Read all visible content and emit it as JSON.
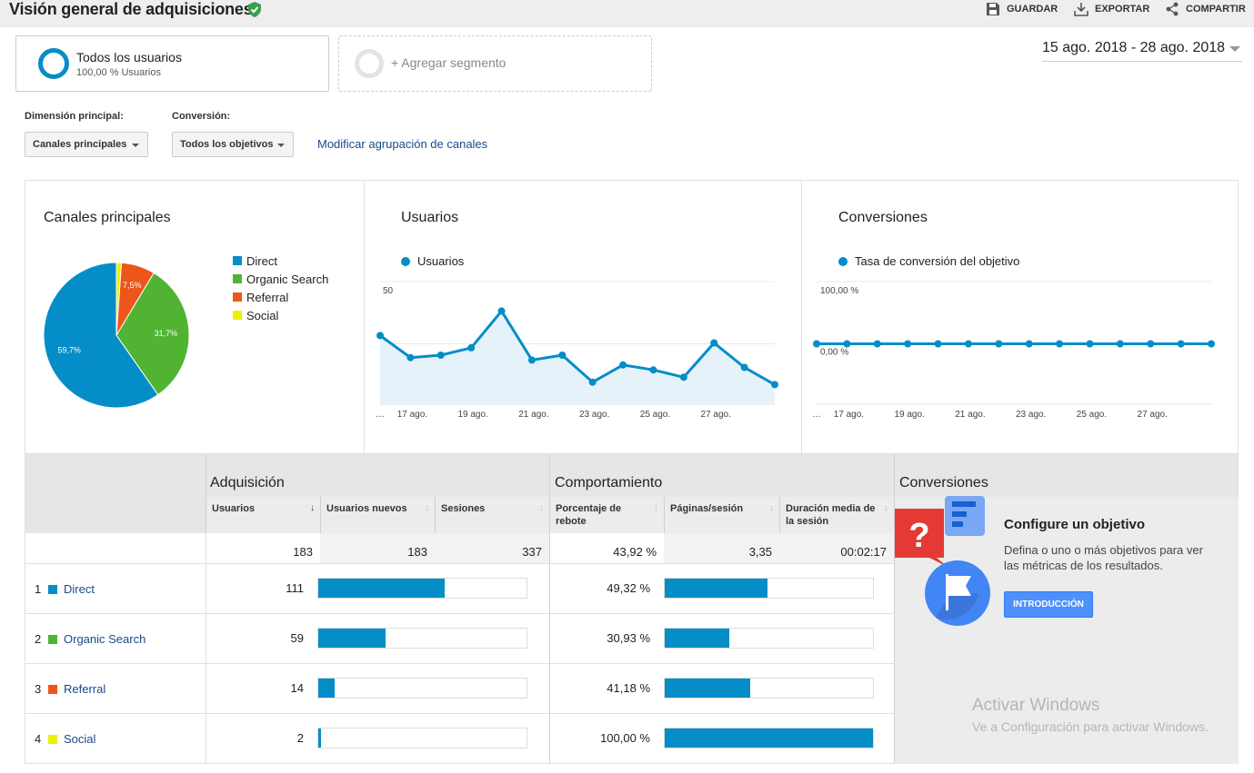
{
  "header": {
    "title": "Visión general de adquisiciones",
    "save_label": "GUARDAR",
    "export_label": "EXPORTAR",
    "share_label": "COMPARTIR"
  },
  "segments": {
    "active_name": "Todos los usuarios",
    "active_sub": "100,00 % Usuarios",
    "add_label": "+ Agregar segmento"
  },
  "date_range": "15 ago. 2018 - 28 ago. 2018",
  "dimensions": {
    "primary_label": "Dimensión principal:",
    "primary_value": "Canales principales",
    "conversion_label": "Conversión:",
    "conversion_value": "Todos los objetivos",
    "modify_link": "Modificar agrupación de canales"
  },
  "colors": {
    "direct": "#058dc7",
    "organic": "#50b432",
    "referral": "#ed561b",
    "social": "#edef00",
    "accent": "#058dc7"
  },
  "chart_data": [
    {
      "type": "pie",
      "title": "Canales principales",
      "categories": [
        "Direct",
        "Organic Search",
        "Referral",
        "Social"
      ],
      "values": [
        59.7,
        31.7,
        7.5,
        1.1
      ],
      "labels": [
        "59,7%",
        "31,7%",
        "7,5%",
        ""
      ]
    },
    {
      "type": "area",
      "title": "Usuarios",
      "series": [
        {
          "name": "Usuarios",
          "values": [
            28,
            19,
            20,
            23,
            38,
            18,
            20,
            9,
            16,
            14,
            11,
            25,
            15,
            8
          ]
        }
      ],
      "yticks": [
        "50",
        "25"
      ],
      "ylim": [
        0,
        50
      ],
      "xticks": [
        "…",
        "17 ago.",
        "19 ago.",
        "21 ago.",
        "23 ago.",
        "25 ago.",
        "27 ago."
      ]
    },
    {
      "type": "line",
      "title": "Conversiones",
      "series": [
        {
          "name": "Tasa de conversión del objetivo",
          "values": [
            0,
            0,
            0,
            0,
            0,
            0,
            0,
            0,
            0,
            0,
            0,
            0,
            0,
            0
          ]
        }
      ],
      "yticks": [
        "100,00 %",
        "0,00 %"
      ],
      "xticks": [
        "…",
        "17 ago.",
        "19 ago.",
        "21 ago.",
        "23 ago.",
        "25 ago.",
        "27 ago."
      ]
    }
  ],
  "table": {
    "group_acq": "Adquisición",
    "group_beh": "Comportamiento",
    "group_conv": "Conversiones",
    "columns": [
      "Usuarios",
      "Usuarios nuevos",
      "Sesiones",
      "Porcentaje de rebote",
      "Páginas/sesión",
      "Duración media de la sesión"
    ],
    "totals": [
      "183",
      "183",
      "337",
      "43,92 %",
      "3,35",
      "00:02:17"
    ],
    "rows": [
      {
        "num": "1",
        "name": "Direct",
        "users": "111",
        "users_fraction": 0.607,
        "bounce": "49,32 %",
        "bounce_fraction": 0.493
      },
      {
        "num": "2",
        "name": "Organic Search",
        "users": "59",
        "users_fraction": 0.322,
        "bounce": "30,93 %",
        "bounce_fraction": 0.309
      },
      {
        "num": "3",
        "name": "Referral",
        "users": "14",
        "users_fraction": 0.077,
        "bounce": "41,18 %",
        "bounce_fraction": 0.412
      },
      {
        "num": "4",
        "name": "Social",
        "users": "2",
        "users_fraction": 0.011,
        "bounce": "100,00 %",
        "bounce_fraction": 1.0
      }
    ]
  },
  "goal": {
    "title": "Configure un objetivo",
    "text": "Defina o uno o más objetivos para ver las métricas de los resultados.",
    "button": "INTRODUCCIÓN"
  },
  "watermark": {
    "line1": "Activar Windows",
    "line2": "Ve a Configuración para activar Windows."
  }
}
